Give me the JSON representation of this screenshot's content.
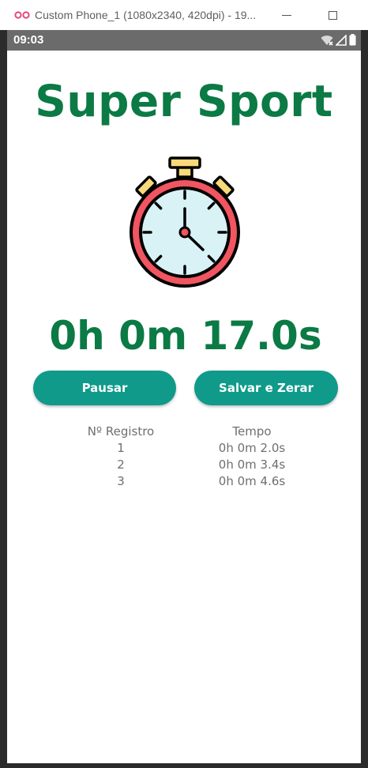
{
  "window": {
    "title": "Custom Phone_1 (1080x2340, 420dpi) - 19...",
    "logo_icon": "emulator-logo-icon",
    "minimize_icon": "minimize-icon",
    "maximize_icon": "maximize-icon"
  },
  "status_bar": {
    "time": "09:03",
    "icons": [
      "wifi-icon",
      "signal-icon",
      "battery-icon"
    ]
  },
  "app": {
    "title": "Super Sport",
    "stopwatch_icon": "stopwatch-icon",
    "timer": "0h 0m 17.0s",
    "buttons": {
      "pause": "Pausar",
      "save_reset": "Salvar e Zerar"
    },
    "records": {
      "headers": [
        "Nº Registro",
        "Tempo"
      ],
      "rows": [
        {
          "num": "1",
          "time": "0h 0m 2.0s"
        },
        {
          "num": "2",
          "time": "0h 0m 3.4s"
        },
        {
          "num": "3",
          "time": "0h 0m 4.6s"
        }
      ]
    }
  },
  "colors": {
    "title_green": "#0b7a44",
    "button_teal": "#0f9a8a",
    "status_bar": "#6b6b6b",
    "stopwatch_red": "#f05560",
    "stopwatch_face": "#d9f2f6",
    "stopwatch_yellow": "#f7d97a"
  }
}
